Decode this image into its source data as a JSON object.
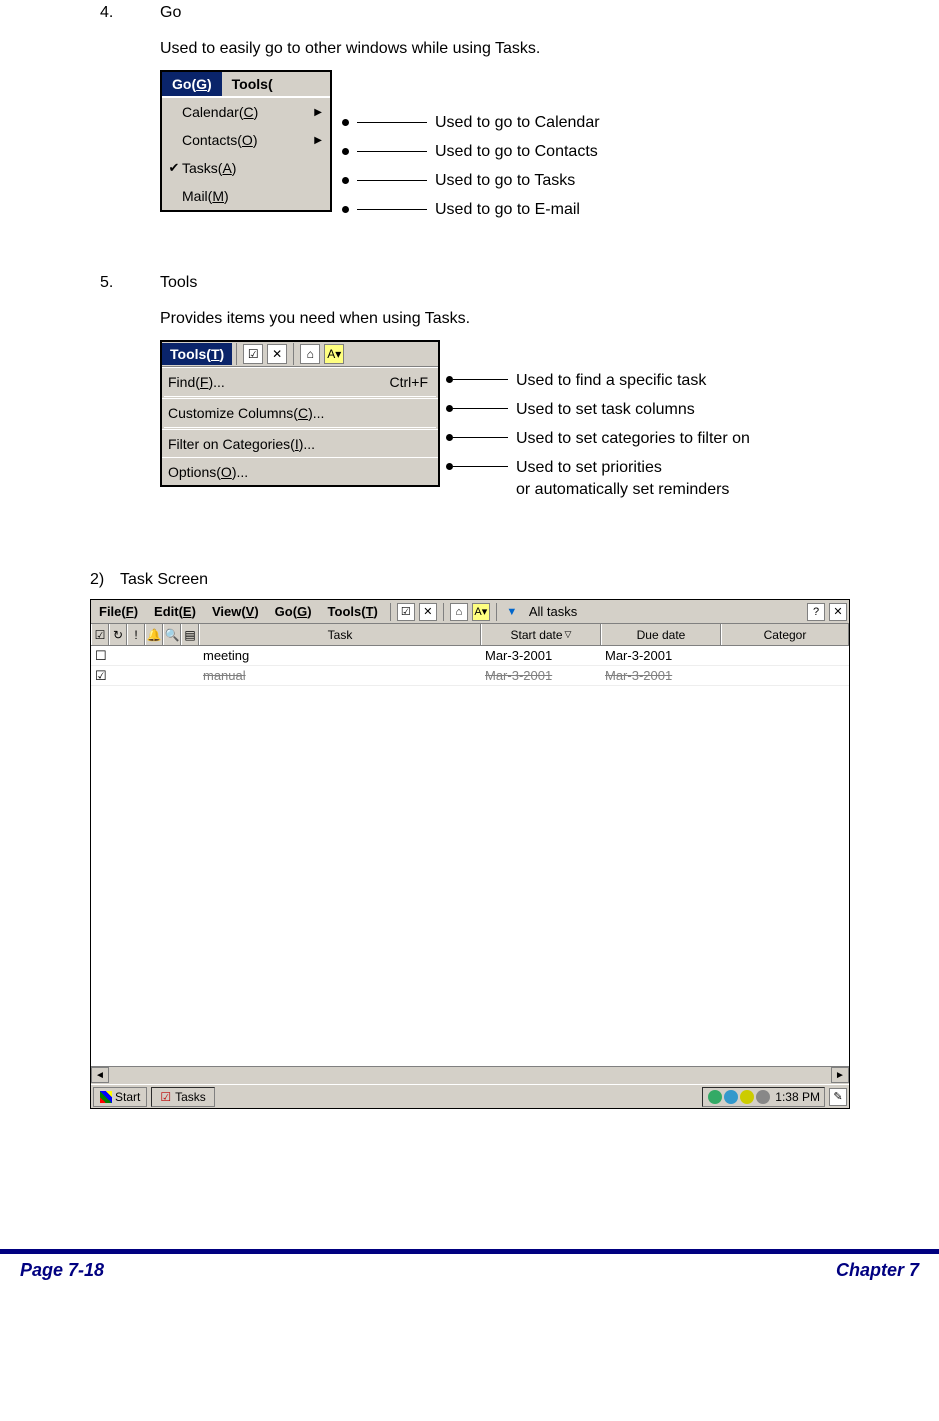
{
  "section4": {
    "num": "4.",
    "title": "Go",
    "desc": "Used to easily go to other windows while using Tasks.",
    "menu": {
      "active_title_pre": "Go(",
      "active_title_u": "G",
      "active_title_post": ")",
      "other_title": "Tools(",
      "items": [
        {
          "pre": "Calendar(",
          "u": "C",
          "post": ")",
          "checked": false,
          "arrow": true,
          "callout": "Used to go to Calendar"
        },
        {
          "pre": "Contacts(",
          "u": "O",
          "post": ")",
          "checked": false,
          "arrow": true,
          "callout": "Used to go to Contacts"
        },
        {
          "pre": "Tasks(",
          "u": "A",
          "post": ")",
          "checked": true,
          "arrow": false,
          "callout": "Used to go to Tasks"
        },
        {
          "pre": "Mail(",
          "u": "M",
          "post": ")",
          "checked": false,
          "arrow": false,
          "callout": "Used to go to E-mail"
        }
      ]
    }
  },
  "section5": {
    "num": "5.",
    "title": "Tools",
    "desc": "Provides items you need when using Tasks.",
    "menu": {
      "active_title_pre": "Tools(",
      "active_title_u": "T",
      "active_title_post": ")",
      "items": [
        {
          "pre": "Find(",
          "u": "F",
          "post": ")...",
          "shortcut": "Ctrl+F",
          "callout": "Used to find a specific task"
        },
        {
          "pre": "Customize Columns(",
          "u": "C",
          "post": ")...",
          "shortcut": "",
          "callout": "Used to set task columns"
        },
        {
          "pre": "Filter on Categories(",
          "u": "I",
          "post": ")...",
          "shortcut": "",
          "callout": "Used to set categories to filter on"
        },
        {
          "pre": "Options(",
          "u": "O",
          "post": ")...",
          "shortcut": "",
          "callout": "Used to set priorities\nor automatically set reminders"
        }
      ]
    }
  },
  "section_ts": {
    "num": "2)",
    "title": "Task Screen",
    "menus": [
      {
        "pre": "File(",
        "u": "F",
        "post": ")"
      },
      {
        "pre": "Edit(",
        "u": "E",
        "post": ")"
      },
      {
        "pre": "View(",
        "u": "V",
        "post": ")"
      },
      {
        "pre": "Go(",
        "u": "G",
        "post": ")"
      },
      {
        "pre": "Tools(",
        "u": "T",
        "post": ")"
      }
    ],
    "filter_label": "All tasks",
    "columns": {
      "task": "Task",
      "start": "Start date",
      "due": "Due date",
      "cat": "Categor"
    },
    "rows": [
      {
        "done": false,
        "task": "meeting",
        "start": "Mar-3-2001",
        "due": "Mar-3-2001"
      },
      {
        "done": true,
        "task": "manual",
        "start": "Mar-3-2001",
        "due": "Mar-3-2001"
      }
    ],
    "taskbar": {
      "start": "Start",
      "app": "Tasks",
      "time": "1:38 PM"
    }
  },
  "footer": {
    "left": "Page 7-18",
    "right": "Chapter 7"
  }
}
